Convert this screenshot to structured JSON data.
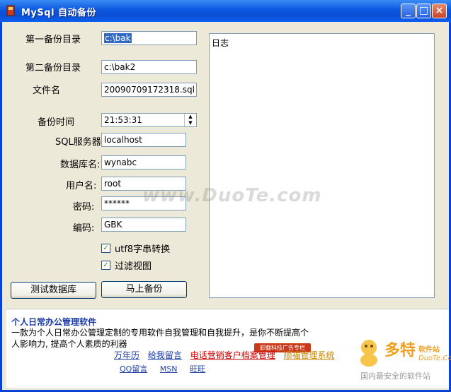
{
  "window": {
    "title": "MySql 自动备份"
  },
  "form": {
    "first_dir_label": "第一备份目录",
    "first_dir_value": "c:\\bak",
    "second_dir_label": "第二备份目录",
    "second_dir_value": "c:\\bak2",
    "file_label": "文件名",
    "file_value": "20090709172318.sql",
    "time_label": "备份时间",
    "time_value": "21:53:31",
    "server_label": "SQL服务器:",
    "server_value": "localhost",
    "db_label": "数据库名:",
    "db_value": "wynabc",
    "user_label": "用户名:",
    "user_value": "root",
    "password_label": "密码:",
    "password_value": "******",
    "encoding_label": "编码:",
    "encoding_value": "GBK",
    "utf8_label": "utf8字串转换",
    "filter_label": "过滤视图"
  },
  "buttons": {
    "test_db": "测试数据库",
    "backup_now": "马上备份"
  },
  "log": {
    "heading": "日志"
  },
  "ad": {
    "title": "个人日常办公管理软件",
    "desc": "一款为个人日常办公管理定制的专用软件自我管理和自我提升，是你不断提高个人影响力, 提高个人素质的利器",
    "links": [
      "万年历",
      "给我留言",
      "电话营销客户档案管理",
      "顺福管理系统"
    ],
    "badge": "卸载科技广告专栏",
    "contacts": [
      "QQ留言",
      "MSN",
      "旺旺"
    ]
  },
  "watermark": "www.DuoTe.com",
  "logo": {
    "name": "多特",
    "sub": "软件站",
    "domain": "DuoTe.Com",
    "tagline": "国内最安全的软件站"
  },
  "colors": {
    "titlebar": "#0a4fd4",
    "selection": "#316ac5",
    "link_red": "#cc0000",
    "link_blue": "#1a3aa8"
  }
}
